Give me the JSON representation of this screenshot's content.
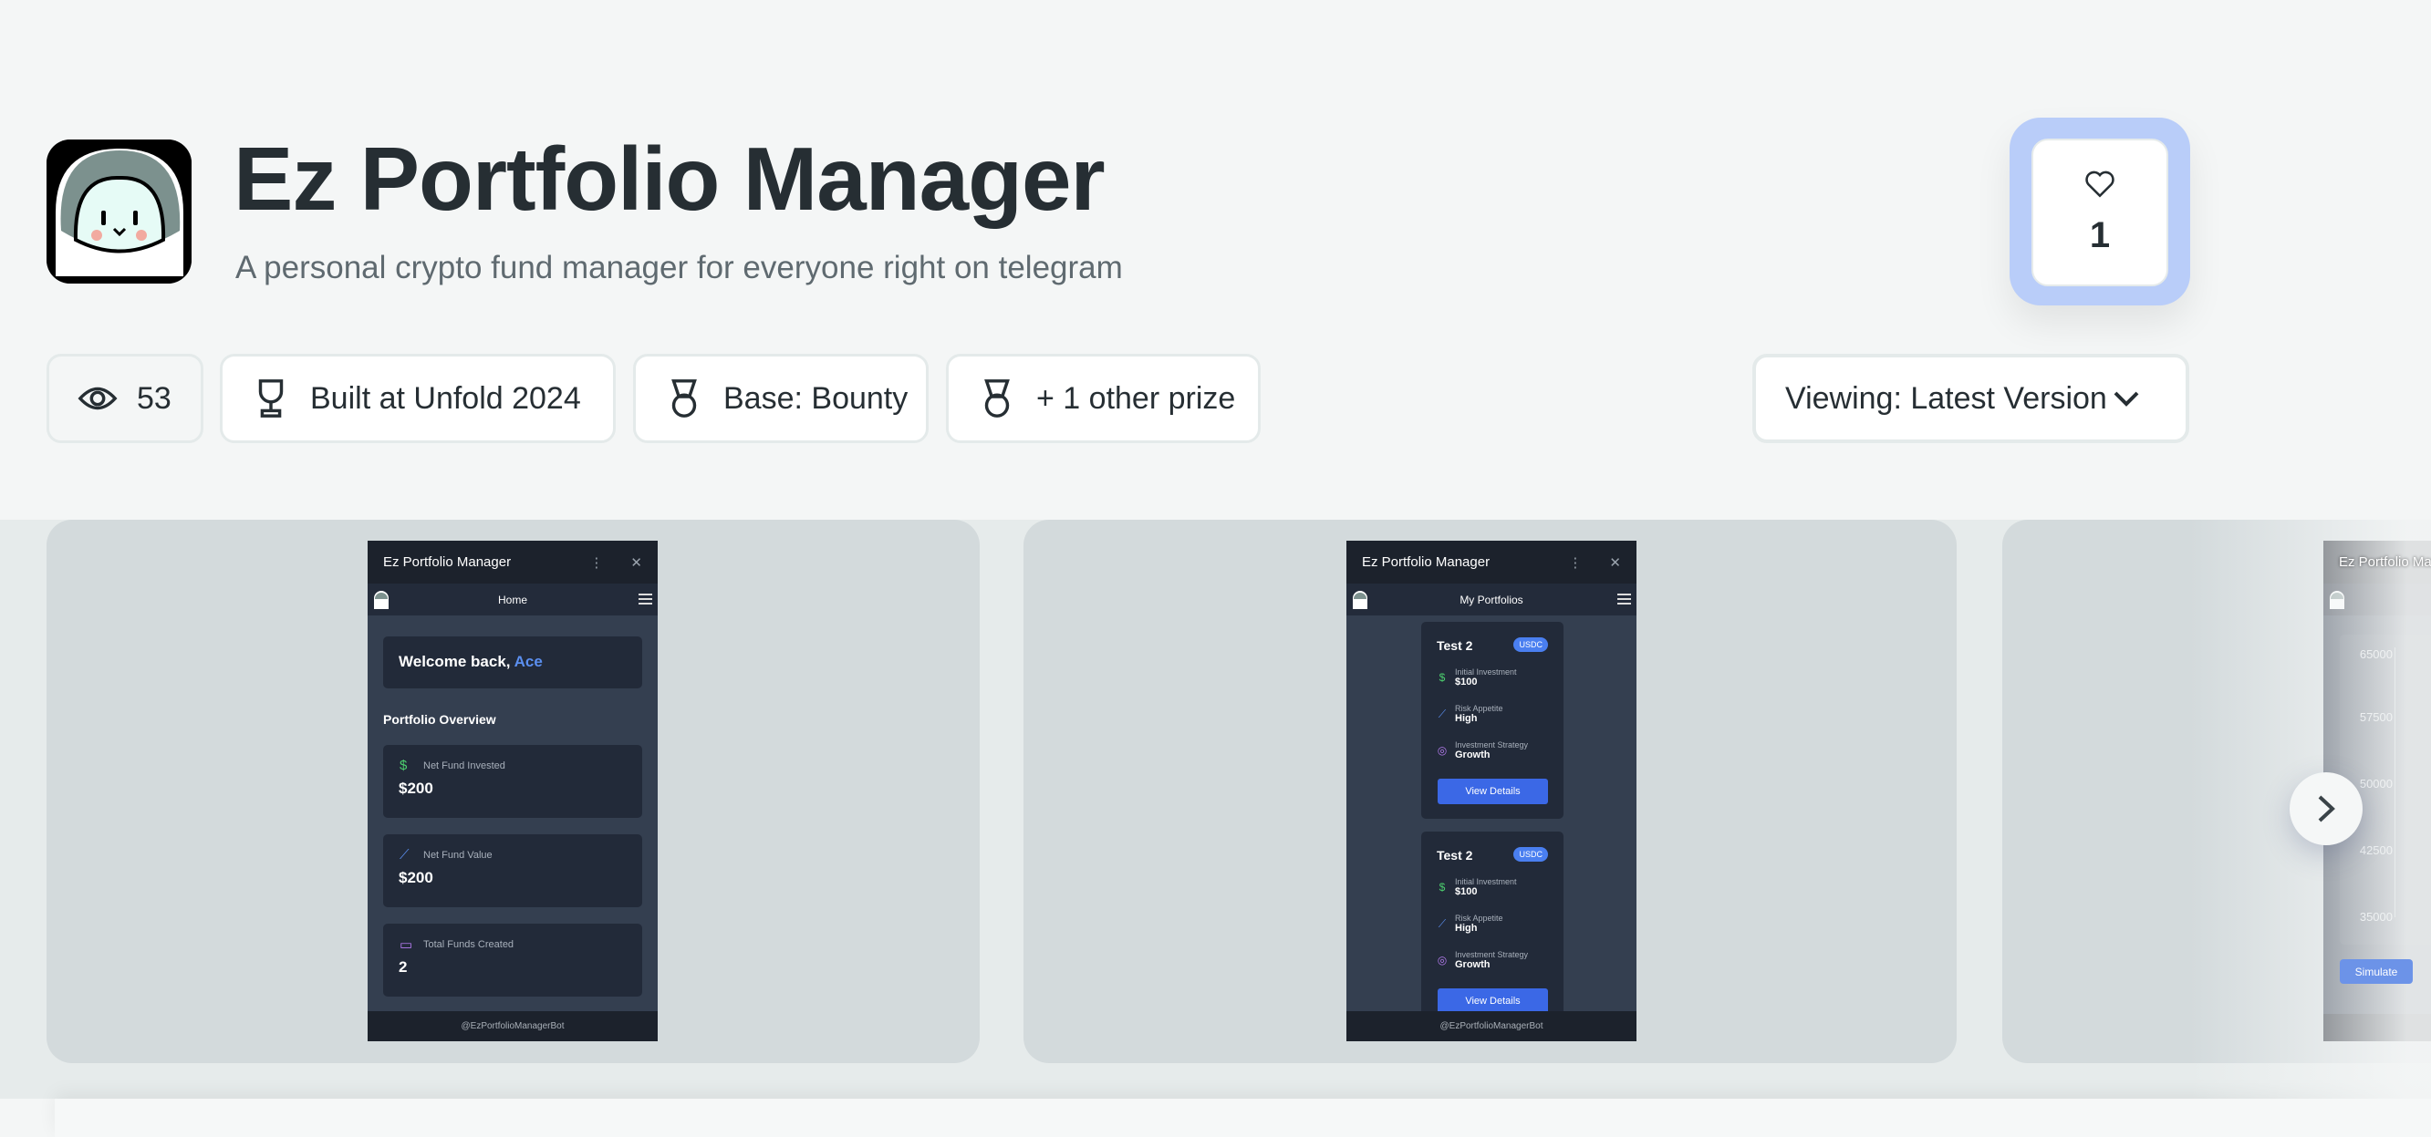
{
  "project": {
    "title": "Ez Portfolio Manager",
    "subtitle": "A personal crypto fund manager for everyone right on telegram"
  },
  "badges": {
    "views": "53",
    "built_at": "Built at Unfold 2024",
    "prize": "Base: Bounty",
    "other_prizes": "+ 1 other prize"
  },
  "likes": {
    "count": "1",
    "icon": "heart-icon"
  },
  "version_select": {
    "label": "Viewing: Latest Version"
  },
  "gallery": {
    "screen1": {
      "app_title": "Ez Portfolio Manager",
      "nav_title": "Home",
      "welcome": "Welcome back, ",
      "user": "Ace",
      "section": "Portfolio Overview",
      "stats": [
        {
          "label": "Net Fund Invested",
          "value": "$200",
          "icon": "dollar-icon"
        },
        {
          "label": "Net Fund Value",
          "value": "$200",
          "icon": "chart-icon"
        },
        {
          "label": "Total Funds Created",
          "value": "2",
          "icon": "wallet-icon"
        }
      ],
      "footer": "@EzPortfolioManagerBot"
    },
    "screen2": {
      "app_title": "Ez Portfolio Manager",
      "nav_title": "My Portfolios",
      "portfolios": [
        {
          "name": "Test 2",
          "token": "USDC",
          "initial_label": "Initial Investment",
          "initial": "$100",
          "risk_label": "Risk Appetite",
          "risk": "High",
          "strategy_label": "Investment Strategy",
          "strategy": "Growth",
          "button": "View Details"
        },
        {
          "name": "Test 2",
          "token": "USDC",
          "initial_label": "Initial Investment",
          "initial": "$100",
          "risk_label": "Risk Appetite",
          "risk": "High",
          "strategy_label": "Investment Strategy",
          "strategy": "Growth",
          "button": "View Details"
        }
      ],
      "footer": "@EzPortfolioManagerBot"
    },
    "screen3": {
      "app_title": "Ez Portfolio Manager",
      "y_ticks": [
        "65000",
        "57500",
        "50000",
        "42500",
        "35000"
      ],
      "button": "Simulate"
    }
  },
  "colors": {
    "accent": "#b9cdf9",
    "button_blue": "#3b68e6",
    "user_highlight": "#5b8ff0"
  }
}
